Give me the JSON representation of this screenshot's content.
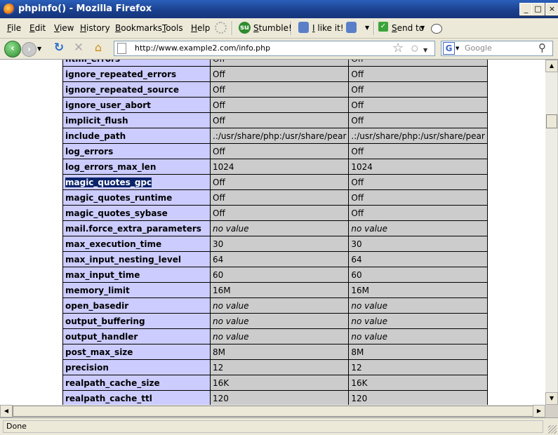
{
  "window": {
    "title": "phpinfo() - Mozilla Firefox"
  },
  "menu": {
    "items": [
      "File",
      "Edit",
      "View",
      "History",
      "Bookmarks",
      "Tools",
      "Help"
    ],
    "stumble_label": "Stumble!",
    "like_label": "I like it!",
    "send_to_label": "Send to"
  },
  "nav": {
    "url": "http://www.example2.com/info.php",
    "search_placeholder": "Google",
    "search_engine_letter": "G"
  },
  "table": {
    "rows": [
      {
        "name": "html_errors",
        "local": "Off",
        "master": "Off"
      },
      {
        "name": "ignore_repeated_errors",
        "local": "Off",
        "master": "Off"
      },
      {
        "name": "ignore_repeated_source",
        "local": "Off",
        "master": "Off"
      },
      {
        "name": "ignore_user_abort",
        "local": "Off",
        "master": "Off"
      },
      {
        "name": "implicit_flush",
        "local": "Off",
        "master": "Off"
      },
      {
        "name": "include_path",
        "local": ".:/usr/share/php:/usr/share/pear",
        "master": ".:/usr/share/php:/usr/share/pear"
      },
      {
        "name": "log_errors",
        "local": "Off",
        "master": "Off"
      },
      {
        "name": "log_errors_max_len",
        "local": "1024",
        "master": "1024"
      },
      {
        "name": "magic_quotes_gpc",
        "local": "Off",
        "master": "Off"
      },
      {
        "name": "magic_quotes_runtime",
        "local": "Off",
        "master": "Off"
      },
      {
        "name": "magic_quotes_sybase",
        "local": "Off",
        "master": "Off"
      },
      {
        "name": "mail.force_extra_parameters",
        "local": "no value",
        "master": "no value"
      },
      {
        "name": "max_execution_time",
        "local": "30",
        "master": "30"
      },
      {
        "name": "max_input_nesting_level",
        "local": "64",
        "master": "64"
      },
      {
        "name": "max_input_time",
        "local": "60",
        "master": "60"
      },
      {
        "name": "memory_limit",
        "local": "16M",
        "master": "16M"
      },
      {
        "name": "open_basedir",
        "local": "no value",
        "master": "no value"
      },
      {
        "name": "output_buffering",
        "local": "no value",
        "master": "no value"
      },
      {
        "name": "output_handler",
        "local": "no value",
        "master": "no value"
      },
      {
        "name": "post_max_size",
        "local": "8M",
        "master": "8M"
      },
      {
        "name": "precision",
        "local": "12",
        "master": "12"
      },
      {
        "name": "realpath_cache_size",
        "local": "16K",
        "master": "16K"
      },
      {
        "name": "realpath_cache_ttl",
        "local": "120",
        "master": "120"
      }
    ],
    "selected_name": "magic_quotes_gpc"
  },
  "status": {
    "text": "Done"
  },
  "colors": {
    "directive_bg": "#ccccff",
    "value_bg": "#cccccc",
    "selection": "#0a246a"
  },
  "icons": [
    "firefox-icon",
    "stumbleupon-icon",
    "thumbs-up-icon",
    "thumbs-down-icon",
    "send-to-icon",
    "comment-icon",
    "back-icon",
    "forward-icon",
    "reload-icon",
    "stop-icon",
    "home-icon",
    "bookmark-star-icon",
    "search-icon"
  ]
}
